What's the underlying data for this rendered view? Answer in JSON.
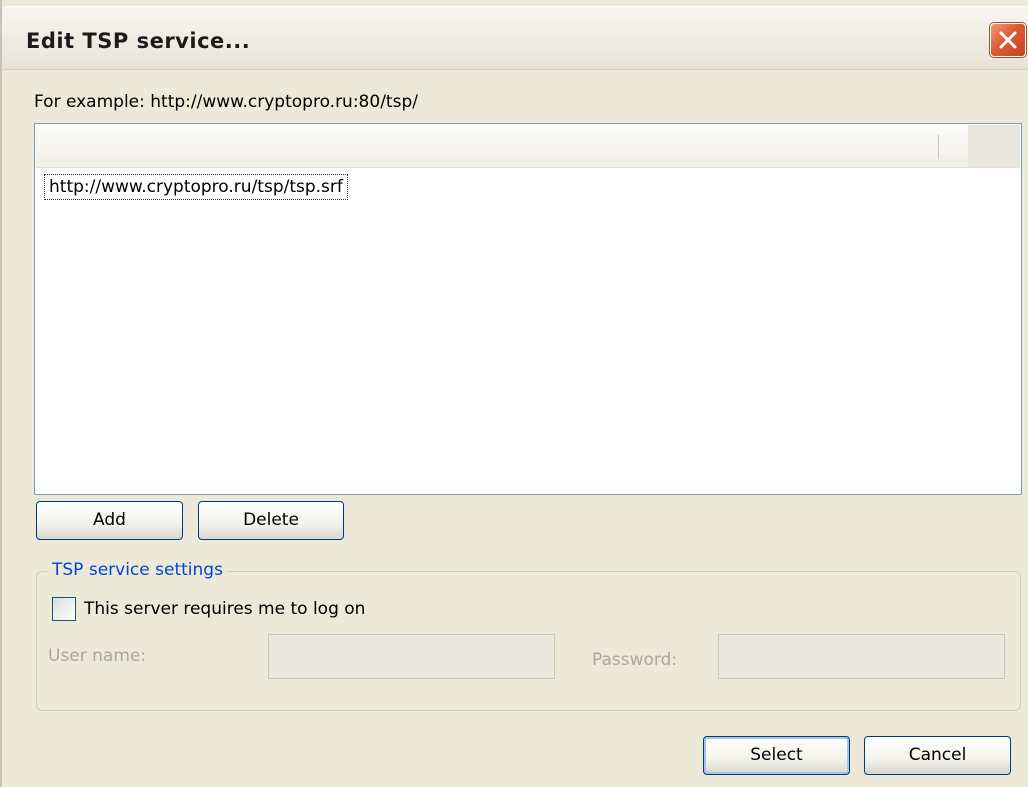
{
  "window": {
    "title": "Edit TSP service..."
  },
  "example_text": "For example: http://www.cryptopro.ru:80/tsp/",
  "service_list": {
    "items": [
      "http://www.cryptopro.ru/tsp/tsp.srf"
    ]
  },
  "list_buttons": {
    "add": "Add",
    "delete": "Delete"
  },
  "settings": {
    "group_title": "TSP service settings",
    "login_checkbox_label": "This server requires me to log on",
    "login_checked": false,
    "user_name_label": "User name:",
    "user_name_value": "",
    "password_label": "Password:",
    "password_value": ""
  },
  "footer": {
    "select": "Select",
    "cancel": "Cancel"
  },
  "colors": {
    "dialog_bg": "#ece9d8",
    "group_title": "#0046d5",
    "close_button": "#dd5b36",
    "disabled_text": "#aca899"
  },
  "icons": {
    "close": "close-icon"
  }
}
